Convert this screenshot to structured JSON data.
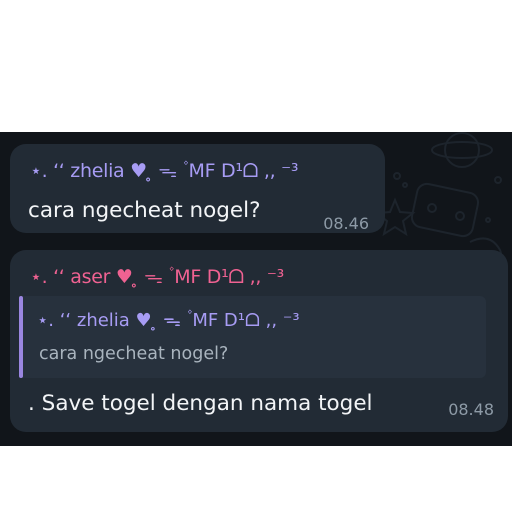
{
  "messages": [
    {
      "sender": "⋆. ‘‘ zhelia ♥︎ ̥ ᯓ ۫ MF D¹ᗝ ,, ⁻³",
      "text": "cara ngecheat nogel?",
      "time": "08.46"
    },
    {
      "sender": "⋆. ‘‘ aser ♥︎ ̥ ᯓ ۫ MF D¹ᗝ ,, ⁻³",
      "reply": {
        "sender": "⋆. ‘‘ zhelia ♥︎ ̥ ᯓ ۫ MF D¹ᗝ ,, ⁻³",
        "text": "cara ngecheat nogel?"
      },
      "text": ". Save togel dengan nama togel",
      "time": "08.48"
    }
  ],
  "colors": {
    "chat_background": "#11151a",
    "bubble": "#222b35",
    "quote_background": "#27313d",
    "quote_bar": "#9a86e0",
    "sender_zhelia": "#a79cf4",
    "sender_aser": "#f06292",
    "message_text": "#f3f5f7",
    "timestamp": "#8d9aa6"
  },
  "background_icons": [
    "planet-doodle",
    "game-controller-doodle",
    "star-doodle",
    "swirl-doodle"
  ]
}
